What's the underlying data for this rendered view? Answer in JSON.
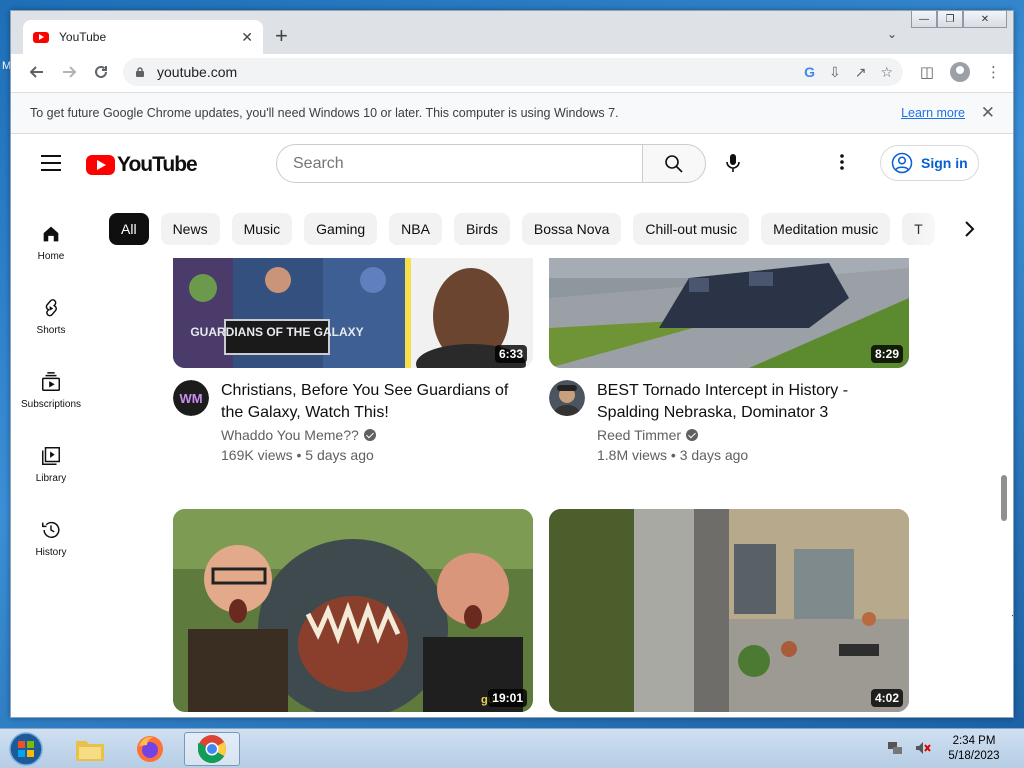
{
  "desktop": {
    "stray_label": "M"
  },
  "browser": {
    "tab_title": "YouTube",
    "url": "youtube.com",
    "infobar_message": "To get future Google Chrome updates, you'll need Windows 10 or later. This computer is using Windows 7.",
    "infobar_link": "Learn more"
  },
  "youtube": {
    "logo_text": "YouTube",
    "search_placeholder": "Search",
    "signin_label": "Sign in",
    "guide": [
      {
        "label": "Home",
        "icon": "home-icon"
      },
      {
        "label": "Shorts",
        "icon": "shorts-icon"
      },
      {
        "label": "Subscriptions",
        "icon": "subscriptions-icon"
      },
      {
        "label": "Library",
        "icon": "library-icon"
      },
      {
        "label": "History",
        "icon": "history-icon"
      }
    ],
    "chips": [
      "All",
      "News",
      "Music",
      "Gaming",
      "NBA",
      "Birds",
      "Bossa Nova",
      "Chill-out music",
      "Meditation music",
      "T"
    ],
    "videos": [
      {
        "title": "Christians, Before You See Guardians of the Galaxy, Watch This!",
        "channel": "Whaddo You Meme??",
        "views": "169K views",
        "age": "5 days ago",
        "duration": "6:33",
        "thumb_text": "GUARDIANS OF THE GALAXY",
        "avatar_text": "WM"
      },
      {
        "title": "BEST Tornado Intercept in History - Spalding Nebraska, Dominator 3",
        "channel": "Reed Timmer",
        "views": "1.8M views",
        "age": "3 days ago",
        "duration": "8:29"
      },
      {
        "duration": "19:01",
        "thumb_text": "gu"
      },
      {
        "duration": "4:02"
      }
    ]
  },
  "taskbar": {
    "time": "2:34 PM",
    "date": "5/18/2023"
  },
  "colors": {
    "yt_red": "#ff0000",
    "link_blue": "#065fd4",
    "chrome_blue": "#1a73e8",
    "desktop_blue": "#2b7dc4"
  }
}
